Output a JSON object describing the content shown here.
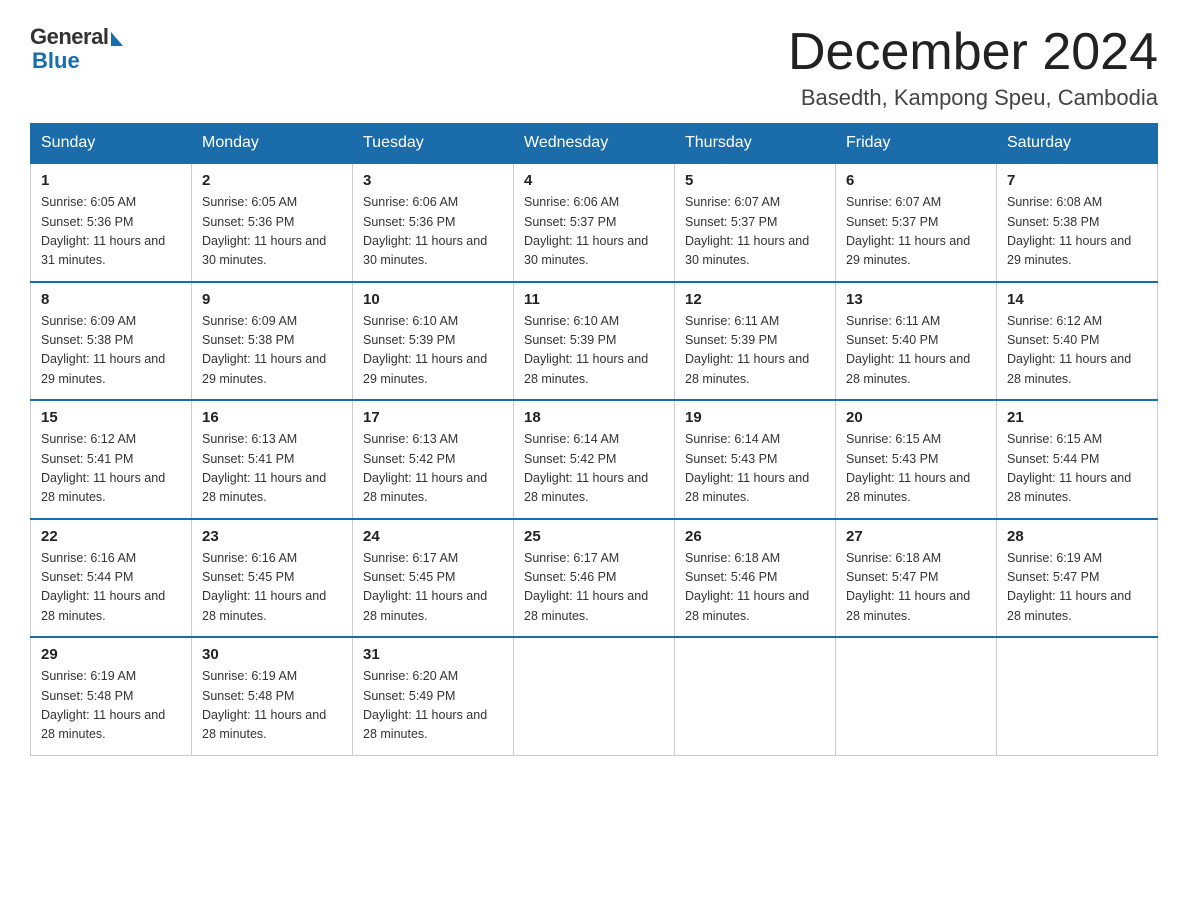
{
  "header": {
    "logo_general": "General",
    "logo_blue": "Blue",
    "month_title": "December 2024",
    "location": "Basedth, Kampong Speu, Cambodia"
  },
  "columns": [
    "Sunday",
    "Monday",
    "Tuesday",
    "Wednesday",
    "Thursday",
    "Friday",
    "Saturday"
  ],
  "weeks": [
    [
      {
        "day": "1",
        "sunrise": "6:05 AM",
        "sunset": "5:36 PM",
        "daylight": "11 hours and 31 minutes."
      },
      {
        "day": "2",
        "sunrise": "6:05 AM",
        "sunset": "5:36 PM",
        "daylight": "11 hours and 30 minutes."
      },
      {
        "day": "3",
        "sunrise": "6:06 AM",
        "sunset": "5:36 PM",
        "daylight": "11 hours and 30 minutes."
      },
      {
        "day": "4",
        "sunrise": "6:06 AM",
        "sunset": "5:37 PM",
        "daylight": "11 hours and 30 minutes."
      },
      {
        "day": "5",
        "sunrise": "6:07 AM",
        "sunset": "5:37 PM",
        "daylight": "11 hours and 30 minutes."
      },
      {
        "day": "6",
        "sunrise": "6:07 AM",
        "sunset": "5:37 PM",
        "daylight": "11 hours and 29 minutes."
      },
      {
        "day": "7",
        "sunrise": "6:08 AM",
        "sunset": "5:38 PM",
        "daylight": "11 hours and 29 minutes."
      }
    ],
    [
      {
        "day": "8",
        "sunrise": "6:09 AM",
        "sunset": "5:38 PM",
        "daylight": "11 hours and 29 minutes."
      },
      {
        "day": "9",
        "sunrise": "6:09 AM",
        "sunset": "5:38 PM",
        "daylight": "11 hours and 29 minutes."
      },
      {
        "day": "10",
        "sunrise": "6:10 AM",
        "sunset": "5:39 PM",
        "daylight": "11 hours and 29 minutes."
      },
      {
        "day": "11",
        "sunrise": "6:10 AM",
        "sunset": "5:39 PM",
        "daylight": "11 hours and 28 minutes."
      },
      {
        "day": "12",
        "sunrise": "6:11 AM",
        "sunset": "5:39 PM",
        "daylight": "11 hours and 28 minutes."
      },
      {
        "day": "13",
        "sunrise": "6:11 AM",
        "sunset": "5:40 PM",
        "daylight": "11 hours and 28 minutes."
      },
      {
        "day": "14",
        "sunrise": "6:12 AM",
        "sunset": "5:40 PM",
        "daylight": "11 hours and 28 minutes."
      }
    ],
    [
      {
        "day": "15",
        "sunrise": "6:12 AM",
        "sunset": "5:41 PM",
        "daylight": "11 hours and 28 minutes."
      },
      {
        "day": "16",
        "sunrise": "6:13 AM",
        "sunset": "5:41 PM",
        "daylight": "11 hours and 28 minutes."
      },
      {
        "day": "17",
        "sunrise": "6:13 AM",
        "sunset": "5:42 PM",
        "daylight": "11 hours and 28 minutes."
      },
      {
        "day": "18",
        "sunrise": "6:14 AM",
        "sunset": "5:42 PM",
        "daylight": "11 hours and 28 minutes."
      },
      {
        "day": "19",
        "sunrise": "6:14 AM",
        "sunset": "5:43 PM",
        "daylight": "11 hours and 28 minutes."
      },
      {
        "day": "20",
        "sunrise": "6:15 AM",
        "sunset": "5:43 PM",
        "daylight": "11 hours and 28 minutes."
      },
      {
        "day": "21",
        "sunrise": "6:15 AM",
        "sunset": "5:44 PM",
        "daylight": "11 hours and 28 minutes."
      }
    ],
    [
      {
        "day": "22",
        "sunrise": "6:16 AM",
        "sunset": "5:44 PM",
        "daylight": "11 hours and 28 minutes."
      },
      {
        "day": "23",
        "sunrise": "6:16 AM",
        "sunset": "5:45 PM",
        "daylight": "11 hours and 28 minutes."
      },
      {
        "day": "24",
        "sunrise": "6:17 AM",
        "sunset": "5:45 PM",
        "daylight": "11 hours and 28 minutes."
      },
      {
        "day": "25",
        "sunrise": "6:17 AM",
        "sunset": "5:46 PM",
        "daylight": "11 hours and 28 minutes."
      },
      {
        "day": "26",
        "sunrise": "6:18 AM",
        "sunset": "5:46 PM",
        "daylight": "11 hours and 28 minutes."
      },
      {
        "day": "27",
        "sunrise": "6:18 AM",
        "sunset": "5:47 PM",
        "daylight": "11 hours and 28 minutes."
      },
      {
        "day": "28",
        "sunrise": "6:19 AM",
        "sunset": "5:47 PM",
        "daylight": "11 hours and 28 minutes."
      }
    ],
    [
      {
        "day": "29",
        "sunrise": "6:19 AM",
        "sunset": "5:48 PM",
        "daylight": "11 hours and 28 minutes."
      },
      {
        "day": "30",
        "sunrise": "6:19 AM",
        "sunset": "5:48 PM",
        "daylight": "11 hours and 28 minutes."
      },
      {
        "day": "31",
        "sunrise": "6:20 AM",
        "sunset": "5:49 PM",
        "daylight": "11 hours and 28 minutes."
      },
      null,
      null,
      null,
      null
    ]
  ]
}
